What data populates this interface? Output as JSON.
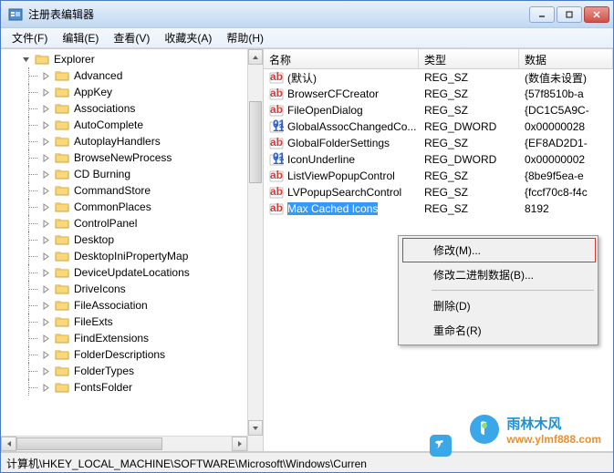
{
  "window": {
    "title": "注册表编辑器"
  },
  "menubar": {
    "file": "文件(F)",
    "edit": "编辑(E)",
    "view": "查看(V)",
    "favorites": "收藏夹(A)",
    "help": "帮助(H)"
  },
  "tree": {
    "root": "Explorer",
    "items": [
      "Advanced",
      "AppKey",
      "Associations",
      "AutoComplete",
      "AutoplayHandlers",
      "BrowseNewProcess",
      "CD Burning",
      "CommandStore",
      "CommonPlaces",
      "ControlPanel",
      "Desktop",
      "DesktopIniPropertyMap",
      "DeviceUpdateLocations",
      "DriveIcons",
      "FileAssociation",
      "FileExts",
      "FindExtensions",
      "FolderDescriptions",
      "FolderTypes",
      "FontsFolder"
    ]
  },
  "columns": {
    "name": "名称",
    "type": "类型",
    "data": "数据"
  },
  "rows": [
    {
      "name": "(默认)",
      "type": "REG_SZ",
      "data": "(数值未设置)",
      "icon": "sz"
    },
    {
      "name": "BrowserCFCreator",
      "type": "REG_SZ",
      "data": "{57f8510b-a",
      "icon": "sz"
    },
    {
      "name": "FileOpenDialog",
      "type": "REG_SZ",
      "data": "{DC1C5A9C-",
      "icon": "sz"
    },
    {
      "name": "GlobalAssocChangedCo...",
      "type": "REG_DWORD",
      "data": "0x00000028",
      "icon": "dw"
    },
    {
      "name": "GlobalFolderSettings",
      "type": "REG_SZ",
      "data": "{EF8AD2D1-",
      "icon": "sz"
    },
    {
      "name": "IconUnderline",
      "type": "REG_DWORD",
      "data": "0x00000002",
      "icon": "dw"
    },
    {
      "name": "ListViewPopupControl",
      "type": "REG_SZ",
      "data": "{8be9f5ea-e",
      "icon": "sz"
    },
    {
      "name": "LVPopupSearchControl",
      "type": "REG_SZ",
      "data": "{fccf70c8-f4c",
      "icon": "sz"
    },
    {
      "name": "Max Cached Icons",
      "type": "REG_SZ",
      "data": "8192",
      "icon": "sz",
      "selected": true
    }
  ],
  "context_menu": {
    "modify": "修改(M)...",
    "modify_binary": "修改二进制数据(B)...",
    "delete": "删除(D)",
    "rename": "重命名(R)"
  },
  "statusbar": {
    "path": "计算机\\HKEY_LOCAL_MACHINE\\SOFTWARE\\Microsoft\\Windows\\Curren"
  },
  "watermark": {
    "title": "雨林木风",
    "url": "www.ylmf888.com"
  }
}
